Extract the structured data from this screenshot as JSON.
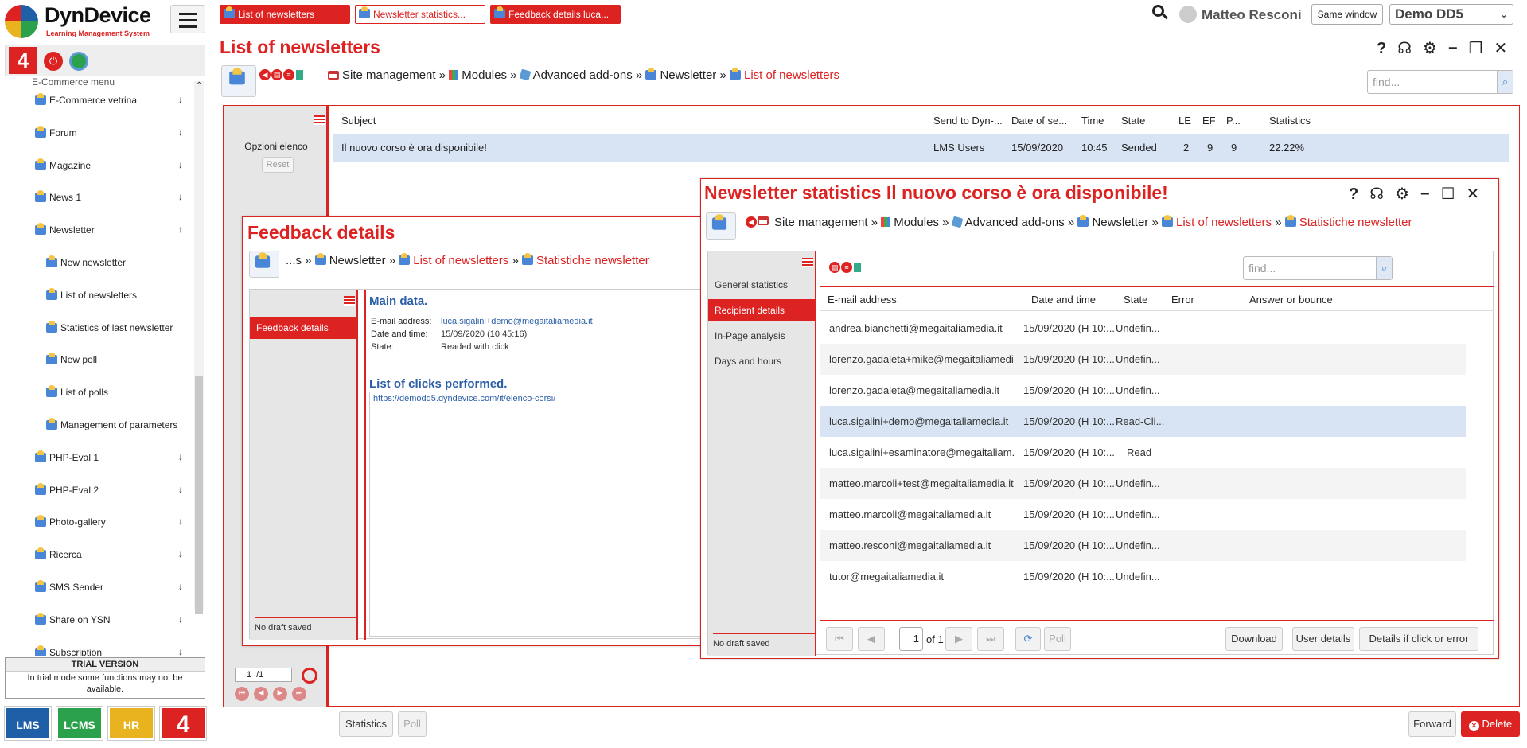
{
  "app": {
    "logo_name": "DynDevice",
    "logo_sub": "Learning Management System",
    "user": "Matteo Resconi",
    "same_window": "Same window",
    "instance": "Demo DD5"
  },
  "task_tabs": [
    "List of newsletters",
    "Newsletter statistics...",
    "Feedback details luca..."
  ],
  "sidebar": {
    "top_partial": "E-Commerce menu",
    "items": [
      {
        "label": "E-Commerce vetrina",
        "arrow": "↓"
      },
      {
        "label": "Forum",
        "arrow": "↓"
      },
      {
        "label": "Magazine",
        "arrow": "↓"
      },
      {
        "label": "News 1",
        "arrow": "↓"
      },
      {
        "label": "Newsletter",
        "arrow": "↑"
      },
      {
        "label": "New newsletter",
        "arrow": ""
      },
      {
        "label": "List of newsletters",
        "arrow": ""
      },
      {
        "label": "Statistics of last newsletter",
        "arrow": ""
      },
      {
        "label": "New poll",
        "arrow": ""
      },
      {
        "label": "List of polls",
        "arrow": ""
      },
      {
        "label": "Management of parameters",
        "arrow": ""
      },
      {
        "label": "PHP-Eval 1",
        "arrow": "↓"
      },
      {
        "label": "PHP-Eval 2",
        "arrow": "↓"
      },
      {
        "label": "Photo-gallery",
        "arrow": "↓"
      },
      {
        "label": "Ricerca",
        "arrow": "↓"
      },
      {
        "label": "SMS Sender",
        "arrow": "↓"
      },
      {
        "label": "Share on YSN",
        "arrow": "↓"
      },
      {
        "label": "Subscription",
        "arrow": "↓"
      }
    ],
    "trial_title": "TRIAL VERSION",
    "trial_text": "In trial mode some functions may not be available.",
    "bottom_tiles": [
      {
        "label": "LMS",
        "color": "#1f5fa8"
      },
      {
        "label": "LCMS",
        "color": "#2aa14a"
      },
      {
        "label": "HR",
        "color": "#e8b31e"
      },
      {
        "label": "4",
        "color": "#d22"
      }
    ]
  },
  "main": {
    "title": "List of newsletters",
    "breadcrumb": [
      "Site management",
      "Modules",
      "Advanced add-ons",
      "Newsletter",
      "List of newsletters"
    ],
    "find_placeholder": "find...",
    "options_label": "Opzioni elenco",
    "reset_label": "Reset",
    "columns": [
      "Subject",
      "Send to Dyn-...",
      "Date of se...",
      "Time",
      "State",
      "LE",
      "EF",
      "P...",
      "Statistics"
    ],
    "row": [
      "Il nuovo corso è ora disponibile!",
      "LMS Users",
      "15/09/2020",
      "10:45",
      "Sended",
      "2",
      "9",
      "9",
      "22.22%"
    ],
    "pager": {
      "page": "1",
      "total": "/1"
    },
    "buttons": {
      "statistics": "Statistics",
      "poll": "Poll",
      "forward": "Forward",
      "delete": "Delete"
    }
  },
  "feedback": {
    "title": "Feedback details",
    "breadcrumb": [
      "...s",
      "Newsletter",
      "List of newsletters",
      "Statistiche newsletter"
    ],
    "tab": "Feedback details",
    "section_main": "Main data.",
    "fields": [
      {
        "label": "E-mail address:",
        "value": "luca.sigalini+demo@megaitaliamedia.it"
      },
      {
        "label": "Date and time:",
        "value": "15/09/2020 (10:45:16)"
      },
      {
        "label": "State:",
        "value": "Readed with click"
      }
    ],
    "section_clicks": "List of clicks performed.",
    "click_url": "https://demodd5.dyndevice.com/it/elenco-corsi/",
    "draft": "No draft saved"
  },
  "stats": {
    "title": "Newsletter statistics Il nuovo corso è ora disponibile!",
    "breadcrumb": [
      "Site management",
      "Modules",
      "Advanced add-ons",
      "Newsletter",
      "List of newsletters",
      "Statistiche newsletter"
    ],
    "find_placeholder": "find...",
    "tabs": [
      "General statistics",
      "Recipient details",
      "In-Page analysis",
      "Days and hours"
    ],
    "columns": [
      "E-mail address",
      "Date and time",
      "State",
      "Error",
      "Answer or bounce"
    ],
    "rows": [
      [
        "andrea.bianchetti@megaitaliamedia.it",
        "15/09/2020 (H 10:...",
        "Undefin..."
      ],
      [
        "lorenzo.gadaleta+mike@megaitaliamedi...",
        "15/09/2020 (H 10:...",
        "Undefin..."
      ],
      [
        "lorenzo.gadaleta@megaitaliamedia.it",
        "15/09/2020 (H 10:...",
        "Undefin..."
      ],
      [
        "luca.sigalini+demo@megaitaliamedia.it",
        "15/09/2020 (H 10:...",
        "Read-Cli..."
      ],
      [
        "luca.sigalini+esaminatore@megaitaliam...",
        "15/09/2020 (H 10:...",
        "Read"
      ],
      [
        "matteo.marcoli+test@megaitaliamedia.it",
        "15/09/2020 (H 10:...",
        "Undefin..."
      ],
      [
        "matteo.marcoli@megaitaliamedia.it",
        "15/09/2020 (H 10:...",
        "Undefin..."
      ],
      [
        "matteo.resconi@megaitaliamedia.it",
        "15/09/2020 (H 10:...",
        "Undefin..."
      ],
      [
        "tutor@megaitaliamedia.it",
        "15/09/2020 (H 10:...",
        "Undefin..."
      ]
    ],
    "pager": {
      "page": "1",
      "of": "of 1"
    },
    "buttons": {
      "poll": "Poll",
      "download": "Download",
      "user_details": "User details",
      "click_error": "Details if click or error"
    },
    "draft": "No draft saved"
  }
}
